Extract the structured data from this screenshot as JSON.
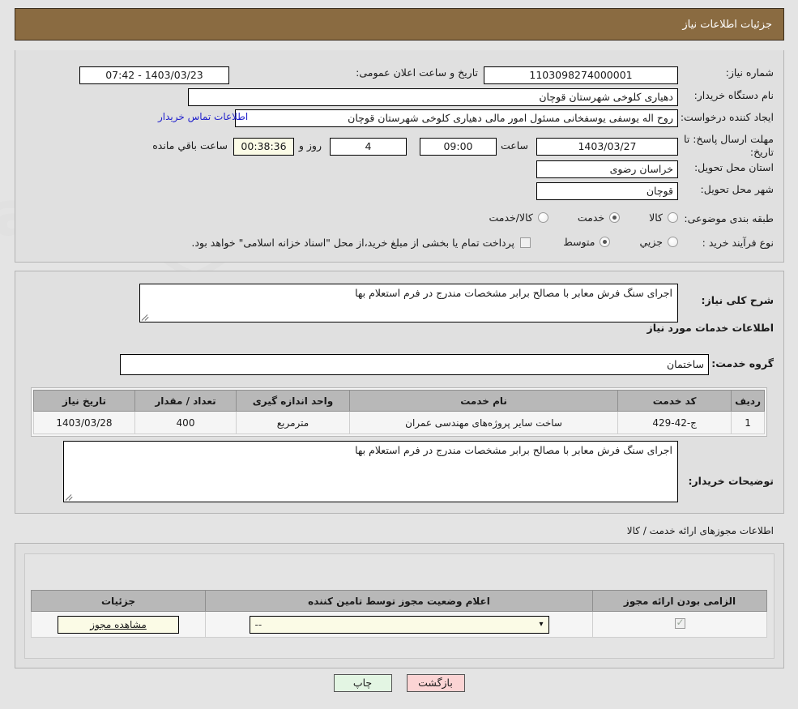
{
  "header": {
    "title": "جزئیات اطلاعات نیاز"
  },
  "fields": {
    "need_number_label": "شماره نیاز:",
    "need_number_value": "1103098274000001",
    "announce_label": "تاریخ و ساعت اعلان عمومی:",
    "announce_value": "1403/03/23 - 07:42",
    "buyer_org_label": "نام دستگاه خریدار:",
    "buyer_org_value": "دهیاری کلوخی  شهرستان قوچان",
    "requester_label": "ایجاد کننده درخواست:",
    "requester_value": "روح اله یوسفی یوسفخانی مسئول امور مالی دهیاری کلوخی  شهرستان قوچان",
    "contact_link": "اطلاعات تماس خریدار",
    "deadline_label": "مهلت ارسال پاسخ: تا تاریخ:",
    "deadline_date": "1403/03/27",
    "time_label": "ساعت",
    "deadline_time": "09:00",
    "days_value": "4",
    "days_label": "روز و",
    "countdown_value": "00:38:36",
    "remaining_label": "ساعت باقي مانده",
    "province_label": "استان محل تحویل:",
    "province_value": "خراسان رضوی",
    "city_label": "شهر محل تحویل:",
    "city_value": "قوچان",
    "category_label": "طبقه بندی موضوعی:",
    "process_label": "نوع فرآیند خرید :",
    "treasury_note": "پرداخت تمام یا بخشی از مبلغ خرید،از محل \"اسناد خزانه اسلامی\" خواهد بود."
  },
  "category_options": [
    {
      "label": "کالا",
      "selected": false
    },
    {
      "label": "خدمت",
      "selected": true
    },
    {
      "label": "کالا/خدمت",
      "selected": false
    }
  ],
  "process_options": [
    {
      "label": "جزیي",
      "selected": false
    },
    {
      "label": "متوسط",
      "selected": true
    }
  ],
  "treasury_checked": false,
  "description": {
    "label": "شرح کلی نیاز:",
    "value": "اجرای سنگ فرش معابر با مصالح برابر مشخصات مندرج در فرم استعلام بها"
  },
  "services_section": {
    "heading": "اطلاعات خدمات مورد نیاز",
    "group_label": "گروه خدمت:",
    "group_value": "ساختمان"
  },
  "services_table": {
    "columns": [
      "ردیف",
      "کد خدمت",
      "نام خدمت",
      "واحد اندازه گیری",
      "تعداد / مقدار",
      "تاریخ نیاز"
    ],
    "rows": [
      {
        "index": "1",
        "code": "ج-42-429",
        "name": "ساخت سایر پروژه‌های مهندسی عمران",
        "unit": "مترمربع",
        "quantity": "400",
        "date": "1403/03/28"
      }
    ]
  },
  "buyer_notes": {
    "label": "توضیحات خریدار:",
    "value": "اجرای سنگ فرش معابر با مصالح برابر مشخصات مندرج در فرم استعلام بها"
  },
  "licenses": {
    "heading": "اطلاعات مجوزهای ارائه خدمت / کالا",
    "columns": [
      "الزامی بودن ارائه مجوز",
      "اعلام وضعیت مجوز توسط تامین کننده",
      "جزئیات"
    ],
    "rows": [
      {
        "required_checked": true,
        "status_value": "--",
        "details_button": "مشاهده مجوز"
      }
    ]
  },
  "footer": {
    "print_label": "چاپ",
    "back_label": "بازگشت"
  },
  "colors": {
    "header_bg": "#8a6b41",
    "link": "#2222cc",
    "service_text": "#7a4a20",
    "print_bg": "#e3f5e3",
    "back_bg": "#fbd4d4",
    "cream": "#fbfbe6"
  }
}
